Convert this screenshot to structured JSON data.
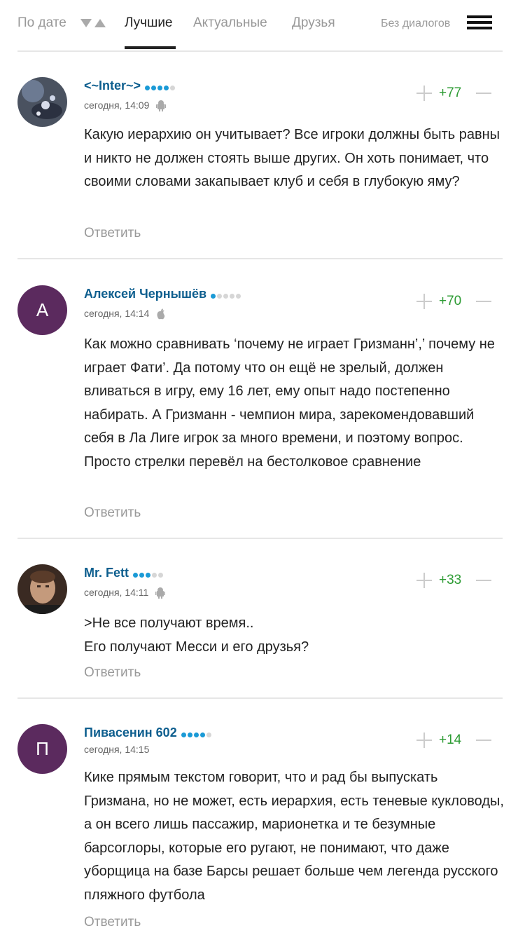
{
  "tabs": {
    "by_date": "По дате",
    "best": "Лучшие",
    "actual": "Актуальные",
    "friends": "Друзья",
    "no_dialogs": "Без диалогов"
  },
  "comments": [
    {
      "name": "<~Inter~>",
      "rating_dots": 4,
      "time": "сегодня, 14:09",
      "device": "android-icon",
      "score": "+77",
      "text": "Какую иерархию он учитывает? Все игроки должны быть равны и никто не должен стоять выше других. Он хоть понимает, что своими словами закапывает клуб и себя в глубокую яму?",
      "reply": "Ответить"
    },
    {
      "name": "Алексей Чернышёв",
      "avatar_letter": "А",
      "rating_dots": 1,
      "time": "сегодня, 14:14",
      "device": "apple-icon",
      "score": "+70",
      "text": "Как можно сравнивать ‘почему не играет Гризманн’,’ почему не играет Фати’. Да потому что он ещё не зрелый, должен вливаться в игру, ему 16 лет, ему опыт надо постепенно набирать. А Гризманн - чемпион мира, зарекомендовавший себя в Ла Лиге игрок за много времени, и поэтому вопрос. Просто стрелки перевёл на бестолковое сравнение",
      "reply": "Ответить"
    },
    {
      "name": "Mr. Fett",
      "rating_dots": 3,
      "time": "сегодня, 14:11",
      "device": "android-icon",
      "score": "+33",
      "text": ">Не все получают время..\nЕго получают Месси и его друзья?",
      "reply": "Ответить"
    },
    {
      "name": "Пивасенин 602",
      "avatar_letter": "П",
      "rating_dots": 4,
      "time": "сегодня, 14:15",
      "device": "",
      "score": "+14",
      "text": "Кике прямым текстом говорит, что и рад бы выпускать Гризмана, но не может, есть иерархия, есть теневые кукловоды, а он всего лишь пассажир, марионетка и те безумные барсоглоры, которые его ругают, не понимают, что даже уборщица на базе Барсы решает больше чем легенда русского пляжного футбола",
      "reply": "Ответить"
    }
  ]
}
